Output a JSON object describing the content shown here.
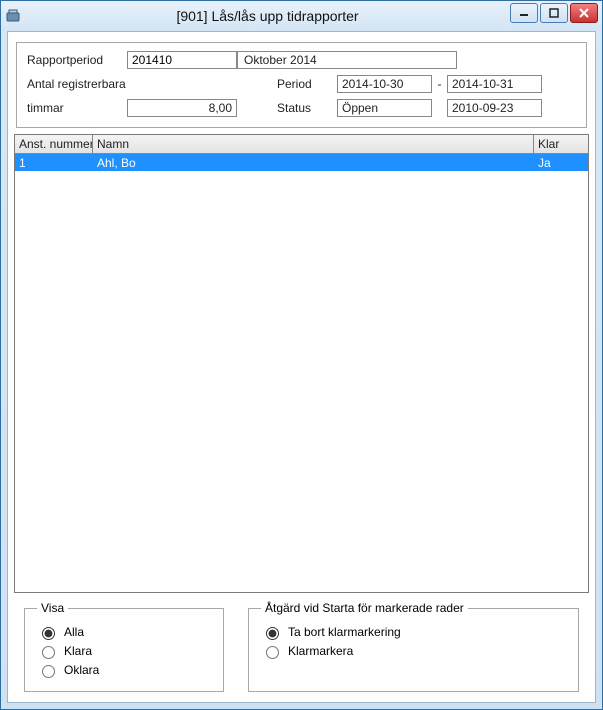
{
  "window": {
    "title": "[901]  Lås/lås upp tidrapporter"
  },
  "form": {
    "rapportperiod_label": "Rapportperiod",
    "rapportperiod_value": "201410",
    "month_display": "Oktober 2014",
    "antal_label_line1": "Antal registrerbara",
    "antal_label_line2": "timmar",
    "antal_value": "8,00",
    "period_label": "Period",
    "period_from": "2014-10-30",
    "period_sep": "-",
    "period_to": "2014-10-31",
    "status_label": "Status",
    "status_value": "Öppen",
    "status_date": "2010-09-23"
  },
  "table": {
    "headers": {
      "nr": "Anst. nummer",
      "namn": "Namn",
      "klar": "Klar"
    },
    "rows": [
      {
        "nr": "1",
        "namn": "Ahl, Bo",
        "klar": "Ja"
      }
    ]
  },
  "filter": {
    "legend": "Visa",
    "alla": "Alla",
    "klara": "Klara",
    "oklara": "Oklara"
  },
  "action": {
    "legend": "Åtgärd vid Starta för markerade rader",
    "remove": "Ta bort klarmarkering",
    "mark": "Klarmarkera"
  }
}
